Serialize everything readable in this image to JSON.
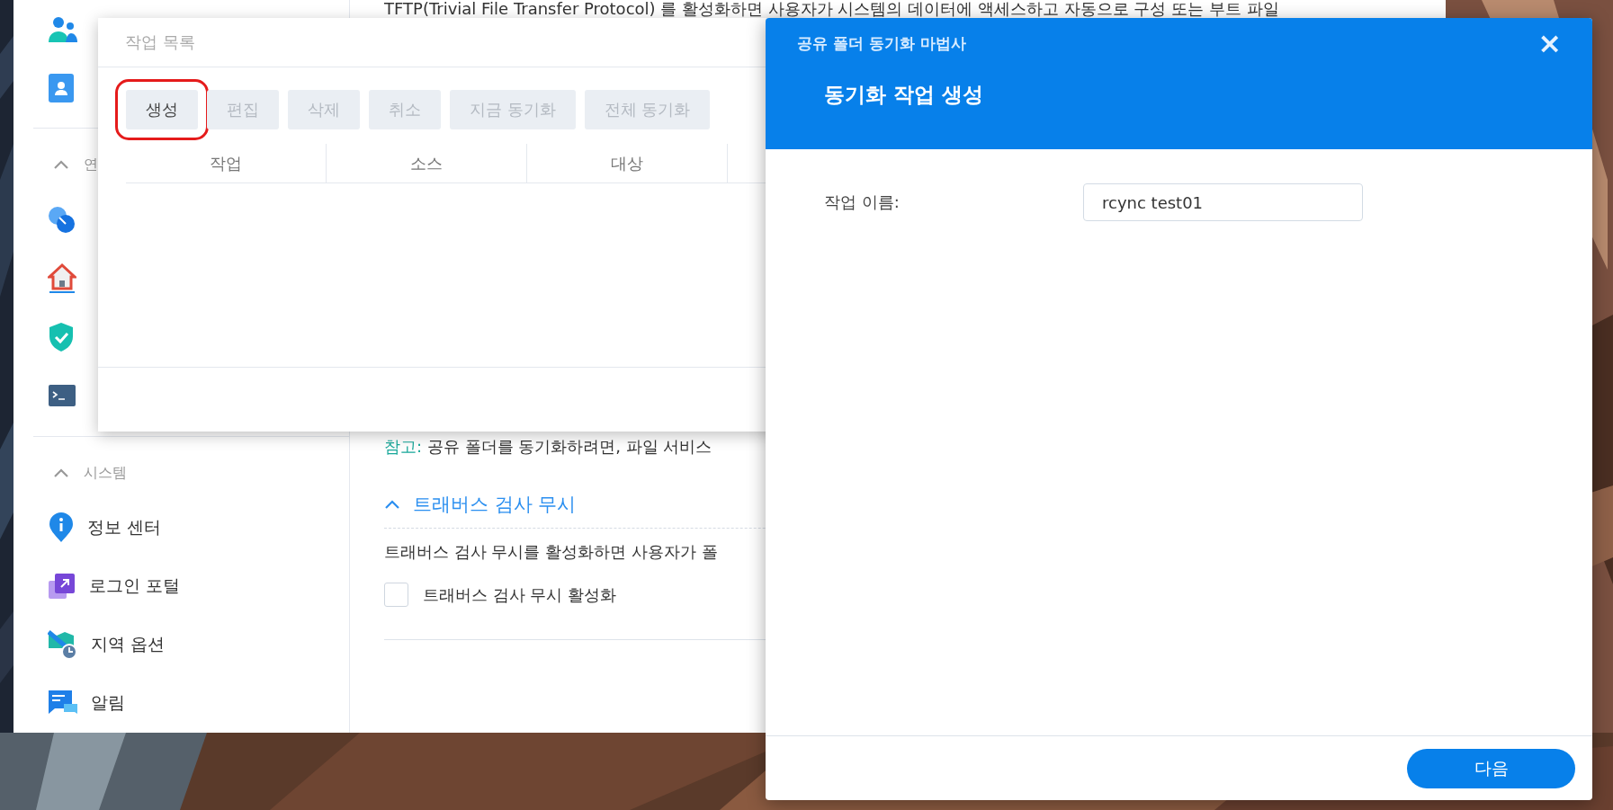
{
  "control_panel": {
    "sidebar": {
      "items": [
        {
          "kind": "item"
        },
        {
          "kind": "item"
        },
        {
          "kind": "divider"
        },
        {
          "kind": "section",
          "label": "연",
          "expanded": true
        },
        {
          "kind": "item"
        },
        {
          "kind": "item"
        },
        {
          "kind": "item"
        },
        {
          "kind": "item"
        },
        {
          "kind": "divider"
        },
        {
          "kind": "section",
          "label": "시스템",
          "expanded": true
        },
        {
          "kind": "item",
          "label": "정보 센터"
        },
        {
          "kind": "item",
          "label": "로그인 포털"
        },
        {
          "kind": "item",
          "label": "지역 옵션"
        },
        {
          "kind": "item",
          "label": "알림"
        }
      ]
    },
    "content": {
      "intro": "TFTP(Trivial File Transfer Protocol) 를 활성화하면 사용자가 시스템의 데이터에 액세스하고 자동으로 구성 또는 부트 파일",
      "note_label": "참고:",
      "note": "공유 폴더를 동기화하려면, 파일 서비스",
      "section": {
        "title": "트래버스 검사 무시",
        "expanded": true,
        "description": "트래버스 검사 무시를 활성화하면 사용자가 폴",
        "checkbox": {
          "label": "트래버스 검사 무시 활성화",
          "checked": false
        }
      }
    }
  },
  "task_list": {
    "title": "작업 목록",
    "buttons": [
      {
        "label": "생성",
        "disabled": false,
        "highlighted": true
      },
      {
        "label": "편집",
        "disabled": true,
        "highlighted": false
      },
      {
        "label": "삭제",
        "disabled": true,
        "highlighted": false
      },
      {
        "label": "취소",
        "disabled": true,
        "highlighted": false
      },
      {
        "label": "지금 동기화",
        "disabled": true,
        "highlighted": false
      },
      {
        "label": "전체 동기화",
        "disabled": true,
        "highlighted": false
      }
    ],
    "columns": [
      "작업",
      "소스",
      "대상"
    ]
  },
  "wizard": {
    "title": "공유 폴더 동기화 마법사",
    "close": "×",
    "step_title": "동기화 작업 생성",
    "fields": [
      {
        "label": "작업 이름:",
        "value": "rcync test01"
      }
    ],
    "buttons": [
      {
        "label": "다음",
        "kind": "primary"
      }
    ]
  }
}
